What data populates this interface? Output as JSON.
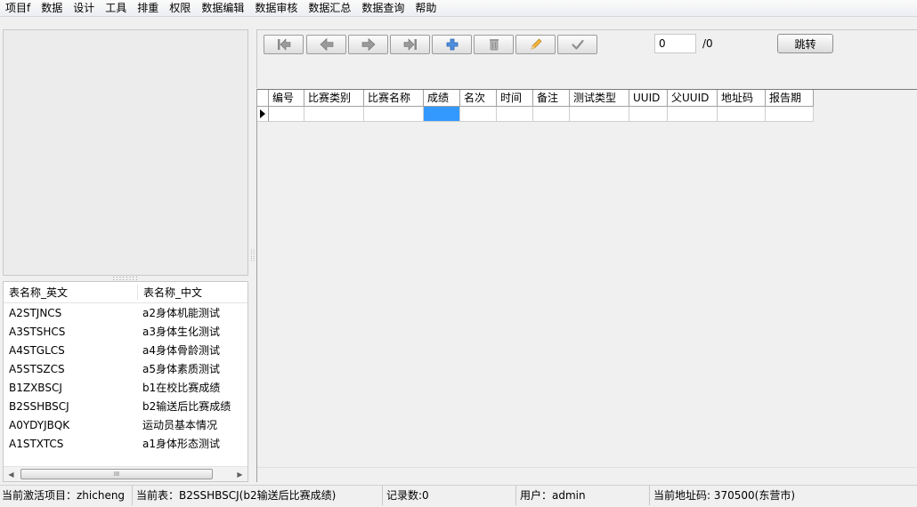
{
  "menu": [
    "项目f",
    "数据",
    "设计",
    "工具",
    "排重",
    "权限",
    "数据编辑",
    "数据审核",
    "数据汇总",
    "数据查询",
    "帮助"
  ],
  "table_list": {
    "headers": [
      "表名称_英文",
      "表名称_中文"
    ],
    "rows": [
      {
        "en": "A2STJNCS",
        "cn": "a2身体机能测试"
      },
      {
        "en": "A3STSHCS",
        "cn": "a3身体生化测试"
      },
      {
        "en": "A4STGLCS",
        "cn": "a4身体骨龄测试"
      },
      {
        "en": "A5STSZCS",
        "cn": "a5身体素质测试"
      },
      {
        "en": "B1ZXBSCJ",
        "cn": "b1在校比赛成绩"
      },
      {
        "en": "B2SSHBSCJ",
        "cn": "b2输送后比赛成绩"
      },
      {
        "en": "A0YDYJBQK",
        "cn": "运动员基本情况"
      },
      {
        "en": "A1STXTCS",
        "cn": "a1身体形态测试"
      }
    ],
    "scroll_thumb_glyph": "III",
    "scroll_left": "◀",
    "scroll_right": "▶"
  },
  "toolbar": {
    "buttons": [
      "first-record",
      "previous-record",
      "next-record",
      "last-record",
      "add-record",
      "delete-record",
      "edit-record",
      "confirm-record"
    ],
    "page_value": "0",
    "page_total": "/0",
    "jump_label": "跳转"
  },
  "grid": {
    "columns": [
      "编号",
      "比赛类别",
      "比赛名称",
      "成绩",
      "名次",
      "时间",
      "备注",
      "测试类型",
      "UUID",
      "父UUID",
      "地址码",
      "报告期"
    ],
    "indicator": "▶"
  },
  "status": {
    "project": "当前激活项目：zhicheng",
    "table": "当前表：B2SSHBSCJ(b2输送后比赛成绩)",
    "records": "记录数:0",
    "user": "用户：admin",
    "address": "当前地址码: 370500(东营市)"
  },
  "colors": {
    "selection": "#3399ff",
    "background": "#f0f0f0"
  }
}
